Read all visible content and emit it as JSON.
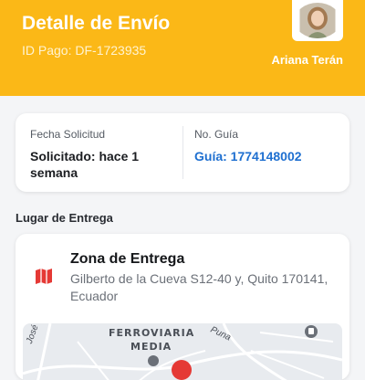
{
  "header": {
    "title": "Detalle de Envío",
    "payment_id": "ID Pago: DF-1723935",
    "user_name": "Ariana Terán"
  },
  "info": {
    "request_label": "Fecha Solicitud",
    "request_value": "Solicitado: hace 1 semana",
    "guide_label": "No. Guía",
    "guide_value": "Guía: 1774148002"
  },
  "delivery": {
    "section_title": "Lugar de Entrega",
    "zone_title": "Zona de Entrega",
    "address": "Gilberto de la Cueva S12-40 y, Quito 170141, Ecuador"
  },
  "map": {
    "area_line1": "FERROVIARIA",
    "area_line2": "MEDIA",
    "street1": "José P",
    "street2": "Puna"
  },
  "colors": {
    "brand": "#fbb817",
    "link": "#1e6fd0",
    "map_marker": "#e53935"
  },
  "icons": {
    "zone_icon": "map-icon",
    "transit_icon": "bus-icon",
    "marker_icon": "map-pin-icon"
  }
}
